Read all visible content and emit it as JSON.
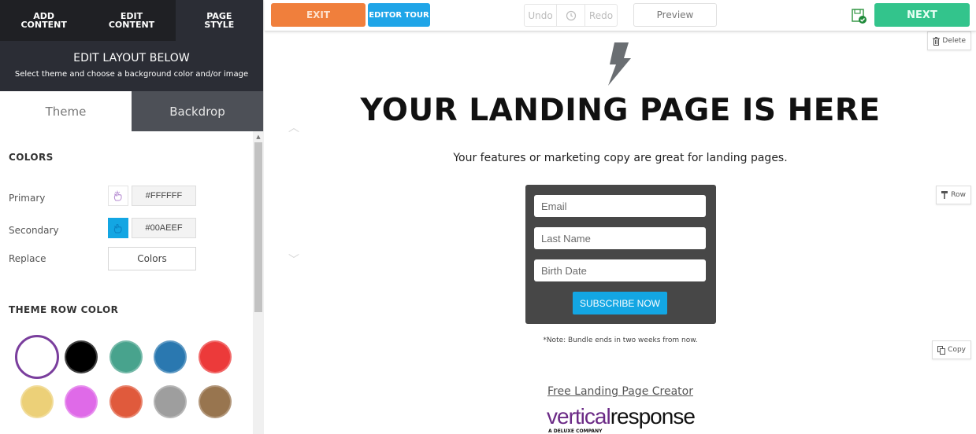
{
  "sidebar": {
    "top_tabs": [
      {
        "line1": "ADD",
        "line2": "CONTENT"
      },
      {
        "line1": "EDIT",
        "line2": "CONTENT"
      },
      {
        "line1": "PAGE",
        "line2": "STYLE"
      }
    ],
    "header": {
      "title": "EDIT LAYOUT BELOW",
      "subtitle": "Select theme and choose a background color and/or image"
    },
    "mode_tabs": [
      "Theme",
      "Backdrop"
    ],
    "colors": {
      "title": "COLORS",
      "primary_label": "Primary",
      "primary_value": "#FFFFFF",
      "secondary_label": "Secondary",
      "secondary_value": "#00AEEF",
      "replace_label": "Replace",
      "replace_button": "Colors"
    },
    "theme_row_color": {
      "title": "THEME ROW COLOR",
      "swatches": [
        "#ffffff",
        "#000000",
        "#48a38d",
        "#2a78b0",
        "#ec3a3a",
        "#ecd078",
        "#df6ae8",
        "#e05a3c",
        "#9e9e9e",
        "#98754f"
      ],
      "selected": "#ffffff"
    }
  },
  "toolbar": {
    "exit": "EXIT",
    "editor_tour": "EDITOR TOUR",
    "undo": "Undo",
    "redo": "Redo",
    "preview": "Preview",
    "next": "NEXT"
  },
  "canvas": {
    "tools": {
      "delete": "Delete",
      "row": "Row",
      "copy": "Copy"
    },
    "headline": "YOUR LANDING PAGE IS HERE",
    "tagline": "Your features or marketing copy are great for landing pages.",
    "form": {
      "email_placeholder": "Email",
      "last_name_placeholder": "Last Name",
      "birth_date_placeholder": "Birth Date",
      "submit": "SUBSCRIBE NOW"
    },
    "note": "*Note: Bundle ends in two weeks from now.",
    "footer_link": "Free Landing Page Creator",
    "logo_part1": "vertical",
    "logo_part2": "response",
    "logo_sub": "A DELUXE COMPANY"
  }
}
